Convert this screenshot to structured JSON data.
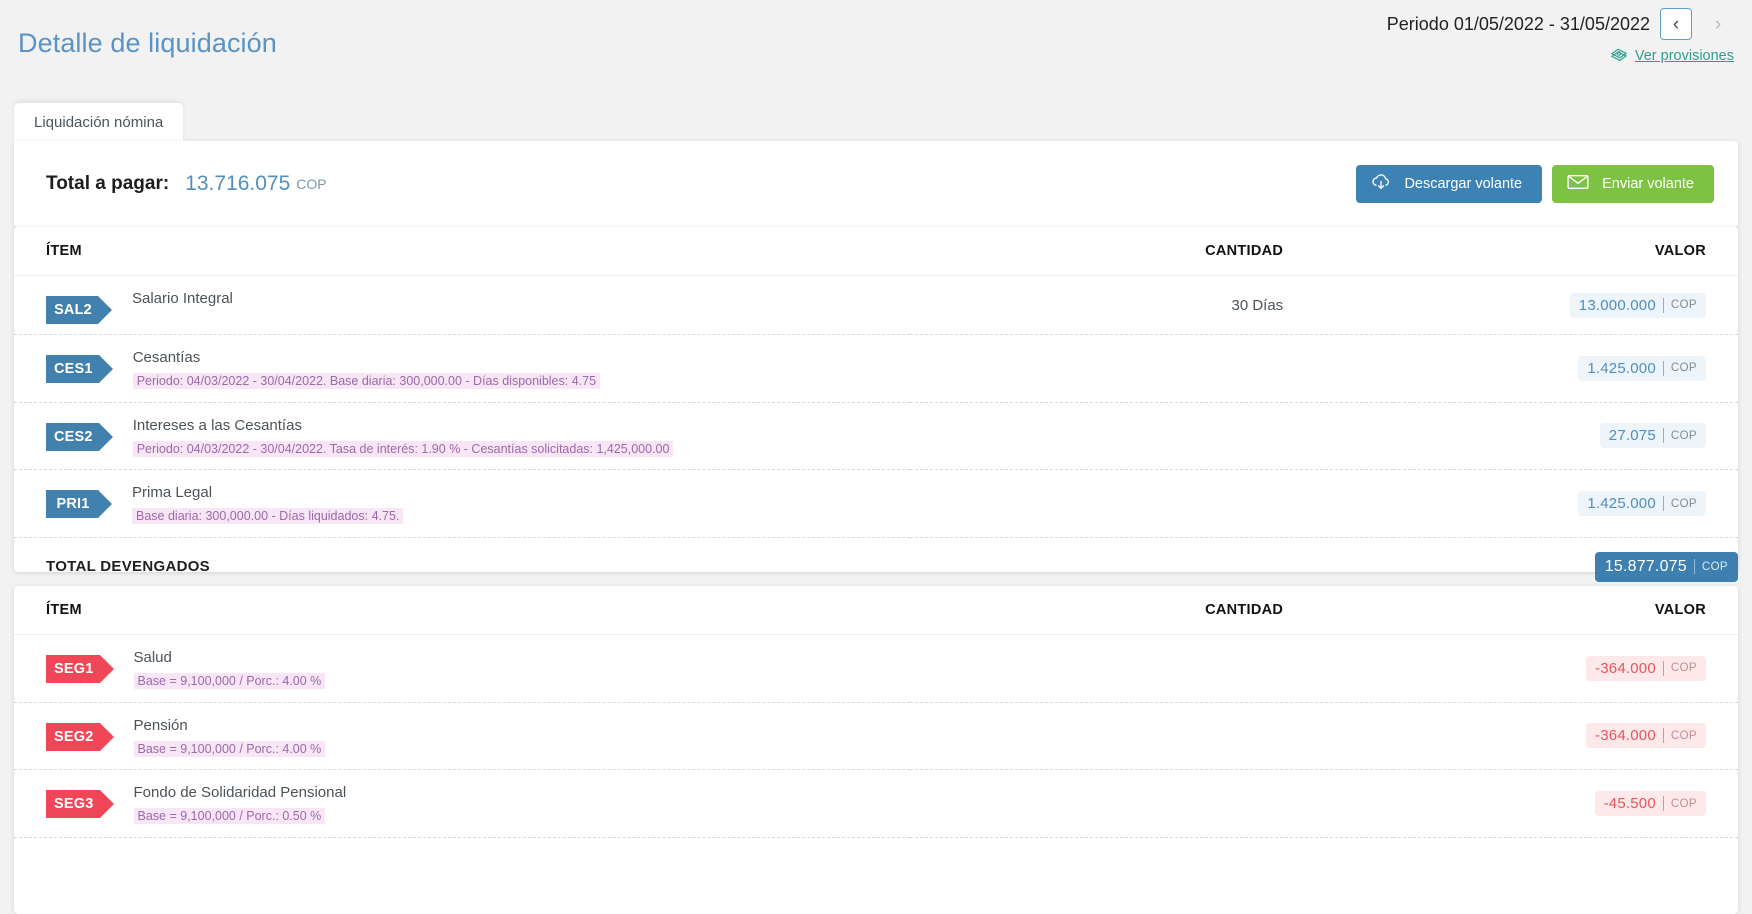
{
  "header": {
    "title": "Detalle de liquidación",
    "period_label": "Periodo 01/05/2022 - 31/05/2022",
    "prev_label": "‹",
    "next_label": "›",
    "provisions_link": "Ver provisiones"
  },
  "tabs": [
    {
      "label": "Liquidación nómina",
      "active": true
    }
  ],
  "summary": {
    "total_label": "Total a pagar:",
    "total_value": "13.716.075",
    "currency": "COP",
    "download_button": "Descargar volante",
    "send_button": "Enviar volante"
  },
  "columns": {
    "item": "ÍTEM",
    "quantity": "CANTIDAD",
    "value": "VALOR"
  },
  "earnings": {
    "rows": [
      {
        "code": "SAL2",
        "name": "Salario Integral",
        "detail": "",
        "quantity": "30  Días",
        "value": "13.000.000",
        "currency": "COP",
        "sign": "pos"
      },
      {
        "code": "CES1",
        "name": "Cesantías",
        "detail": "Periodo: 04/03/2022 - 30/04/2022. Base diaria: 300,000.00 - Días disponibles: 4.75",
        "quantity": "",
        "value": "1.425.000",
        "currency": "COP",
        "sign": "pos"
      },
      {
        "code": "CES2",
        "name": "Intereses a las Cesantías",
        "detail": "Periodo: 04/03/2022 - 30/04/2022. Tasa de interés: 1.90 % - Cesantías solicitadas: 1,425,000.00",
        "quantity": "",
        "value": "27.075",
        "currency": "COP",
        "sign": "pos"
      },
      {
        "code": "PRI1",
        "name": "Prima Legal",
        "detail": "Base diaria: 300,000.00 - Días liquidados: 4.75.",
        "quantity": "",
        "value": "1.425.000",
        "currency": "COP",
        "sign": "pos"
      }
    ],
    "total_label": "TOTAL DEVENGADOS",
    "total_value": "15.877.075",
    "total_currency": "COP"
  },
  "deductions": {
    "rows": [
      {
        "code": "SEG1",
        "name": "Salud",
        "detail": "Base = 9,100,000 / Porc.: 4.00 %",
        "quantity": "",
        "value": "-364.000",
        "currency": "COP",
        "sign": "neg"
      },
      {
        "code": "SEG2",
        "name": "Pensión",
        "detail": "Base = 9,100,000 / Porc.: 4.00 %",
        "quantity": "",
        "value": "-364.000",
        "currency": "COP",
        "sign": "neg"
      },
      {
        "code": "SEG3",
        "name": "Fondo de Solidaridad Pensional",
        "detail": "Base = 9,100,000 / Porc.: 0.50 %",
        "quantity": "",
        "value": "-45.500",
        "currency": "COP",
        "sign": "neg"
      }
    ]
  },
  "colors": {
    "title_blue": "#5a93c4",
    "tag_blue": "#4281ad",
    "tag_red": "#ef4757",
    "btn_blue": "#3d82b5",
    "btn_green": "#7dc242",
    "link_teal": "#2f9e8f",
    "detail_purple": "#9b6aa8"
  }
}
